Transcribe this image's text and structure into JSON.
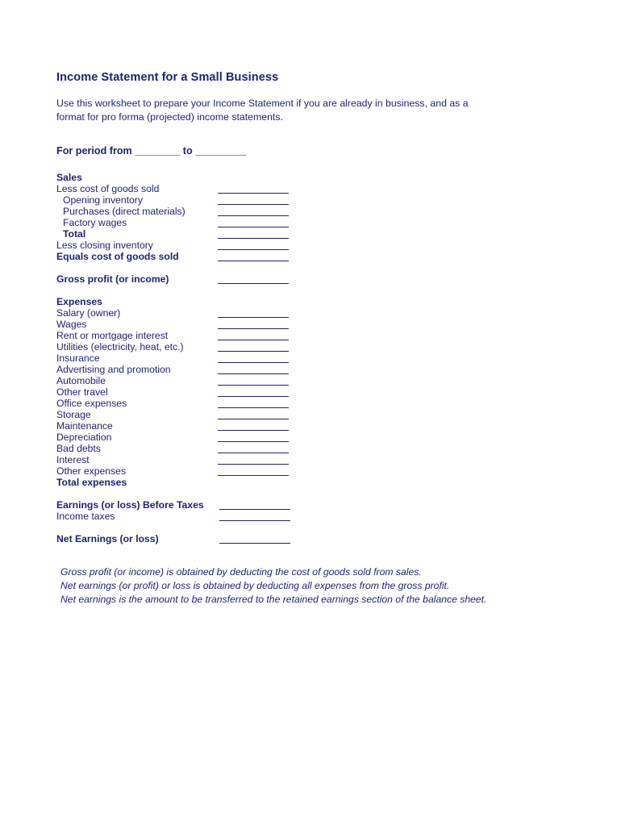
{
  "document": {
    "title": "Income Statement for a Small Business",
    "intro": "Use this worksheet to prepare your Income Statement if you are already in business, and as a format for pro forma (projected) income statements.",
    "period_line": "For period from ________ to _________",
    "text_color": "#1f1f73",
    "rule_color": "#23235f",
    "background": "#ffffff"
  },
  "sales_section": {
    "heading": "Sales",
    "rows": [
      {
        "label": "Less cost of goods sold",
        "rule": true,
        "bold": false,
        "indent": false
      },
      {
        "label": "Opening inventory",
        "rule": true,
        "bold": false,
        "indent": true
      },
      {
        "label": "Purchases (direct materials)",
        "rule": true,
        "bold": false,
        "indent": true
      },
      {
        "label": "Factory wages",
        "rule": true,
        "bold": false,
        "indent": true
      },
      {
        "label": "Total",
        "rule": true,
        "bold": true,
        "indent": true
      },
      {
        "label": "Less closing inventory",
        "rule": true,
        "bold": false,
        "indent": false
      },
      {
        "label": "Equals cost of goods sold",
        "rule": true,
        "bold": true,
        "indent": false
      }
    ]
  },
  "gross_profit": {
    "label": "Gross profit (or income)",
    "rule": true
  },
  "expenses_section": {
    "heading": "Expenses",
    "rows": [
      {
        "label": "Salary (owner)",
        "rule": true
      },
      {
        "label": "Wages",
        "rule": true
      },
      {
        "label": "Rent or mortgage interest",
        "rule": true
      },
      {
        "label": "Utilities (electricity, heat, etc.)",
        "rule": true
      },
      {
        "label": "Insurance",
        "rule": true
      },
      {
        "label": "Advertising and promotion",
        "rule": true
      },
      {
        "label": "Automobile",
        "rule": true
      },
      {
        "label": "Other travel",
        "rule": true
      },
      {
        "label": "Office expenses",
        "rule": true
      },
      {
        "label": "Storage",
        "rule": true
      },
      {
        "label": "Maintenance",
        "rule": true
      },
      {
        "label": "Depreciation",
        "rule": true
      },
      {
        "label": "Bad debts",
        "rule": true
      },
      {
        "label": "Interest",
        "rule": true
      },
      {
        "label": "Other expenses",
        "rule": true
      }
    ],
    "total_label": "Total expenses"
  },
  "earnings_section": {
    "before_taxes_label": "Earnings (or loss) Before Taxes",
    "income_taxes_label": "Income taxes",
    "net_earnings_label": "Net Earnings (or loss)"
  },
  "notes": [
    "Gross profit (or income) is obtained by deducting the cost of goods sold from sales.",
    "Net earnings (or profit) or loss is obtained by deducting all expenses from the gross profit.",
    "Net earnings is the amount to be transferred to the retained earnings section of the balance sheet."
  ]
}
